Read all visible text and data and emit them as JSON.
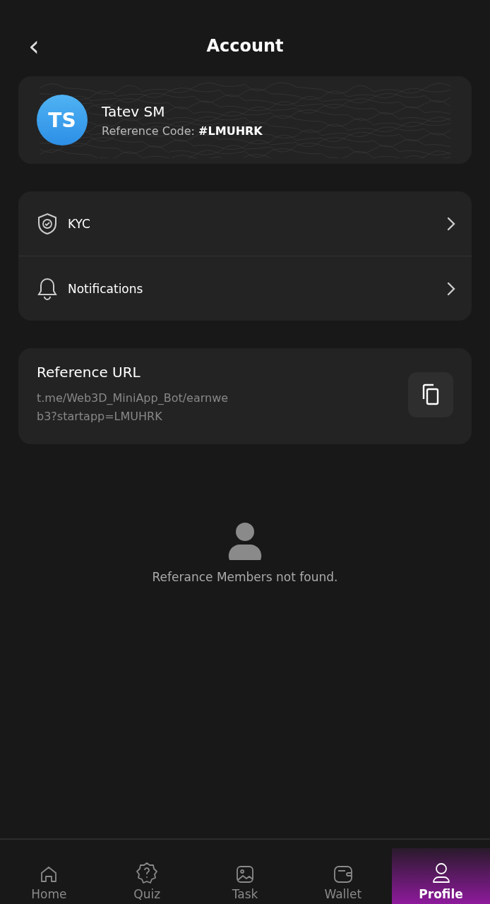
{
  "header": {
    "back": "‹",
    "title": "Account"
  },
  "profile": {
    "initials": "TS",
    "name": "Tatev SM",
    "code_label": "Reference Code:",
    "code": "#LMUHRK"
  },
  "menu": [
    {
      "kind": "shield",
      "label": "KYC"
    },
    {
      "kind": "bell",
      "label": "Notifications"
    }
  ],
  "reference": {
    "title": "Reference URL",
    "url": "t.me/Web3D_MiniApp_Bot/earnweb3?startapp=LMUHRK"
  },
  "empty_state": {
    "message": "Referance Members not found."
  },
  "nav": [
    {
      "kind": "home",
      "label": "Home",
      "selected": false
    },
    {
      "kind": "quiz",
      "label": "Quiz",
      "selected": false
    },
    {
      "kind": "task",
      "label": "Task",
      "selected": false
    },
    {
      "kind": "wallet",
      "label": "Wallet",
      "selected": false
    },
    {
      "kind": "profile",
      "label": "Profile",
      "selected": true
    }
  ]
}
